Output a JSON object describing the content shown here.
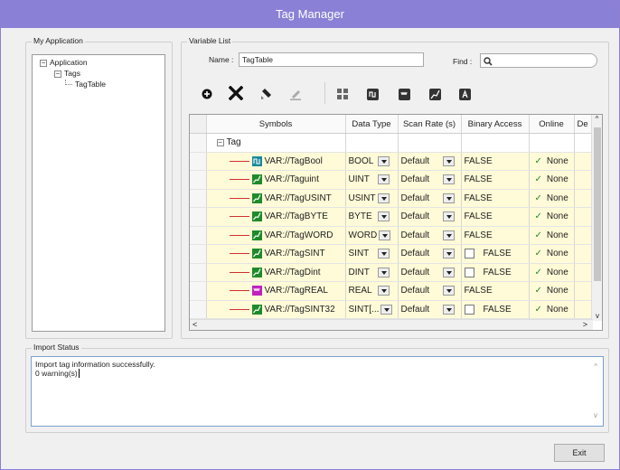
{
  "window": {
    "title": "Tag Manager"
  },
  "app_panel": {
    "title": "My Application",
    "tree": [
      {
        "label": "Application",
        "toggle": "−"
      },
      {
        "label": "Tags",
        "toggle": "−"
      },
      {
        "label": "TagTable",
        "toggle": ""
      }
    ]
  },
  "variable_list": {
    "title": "Variable List",
    "name_label": "Name :",
    "name_value": "TagTable",
    "find_label": "Find :",
    "find_value": ""
  },
  "toolbar": {
    "icons": [
      "add-icon",
      "delete-icon",
      "rename-icon",
      "edit-icon",
      "bool-type-icon",
      "uint-type-icon",
      "real-type-icon",
      "int-type-icon",
      "string-type-icon"
    ]
  },
  "grid": {
    "columns": [
      "Symbols",
      "Data Type",
      "Scan Rate (s)",
      "Binary Access",
      "Online",
      "De"
    ],
    "group_label": "Tag",
    "rows": [
      {
        "symbol": "VAR://TagBool",
        "icon": "bool",
        "data_type": "BOOL",
        "scan_rate": "Default",
        "binary_access": "FALSE",
        "binary_checkbox": false,
        "online": "None"
      },
      {
        "symbol": "VAR://Taguint",
        "icon": "int",
        "data_type": "UINT",
        "scan_rate": "Default",
        "binary_access": "FALSE",
        "binary_checkbox": false,
        "online": "None"
      },
      {
        "symbol": "VAR://TagUSINT",
        "icon": "int",
        "data_type": "USINT",
        "scan_rate": "Default",
        "binary_access": "FALSE",
        "binary_checkbox": false,
        "online": "None"
      },
      {
        "symbol": "VAR://TagBYTE",
        "icon": "int",
        "data_type": "BYTE",
        "scan_rate": "Default",
        "binary_access": "FALSE",
        "binary_checkbox": false,
        "online": "None"
      },
      {
        "symbol": "VAR://TagWORD",
        "icon": "int",
        "data_type": "WORD",
        "scan_rate": "Default",
        "binary_access": "FALSE",
        "binary_checkbox": false,
        "online": "None"
      },
      {
        "symbol": "VAR://TagSINT",
        "icon": "int",
        "data_type": "SINT",
        "scan_rate": "Default",
        "binary_access": "FALSE",
        "binary_checkbox": true,
        "online": "None"
      },
      {
        "symbol": "VAR://TagDint",
        "icon": "int",
        "data_type": "DINT",
        "scan_rate": "Default",
        "binary_access": "FALSE",
        "binary_checkbox": true,
        "online": "None"
      },
      {
        "symbol": "VAR://TagREAL",
        "icon": "real",
        "data_type": "REAL",
        "scan_rate": "Default",
        "binary_access": "FALSE",
        "binary_checkbox": false,
        "online": "None"
      },
      {
        "symbol": "VAR://TagSINT32",
        "icon": "int",
        "data_type": "SINT[...",
        "scan_rate": "Default",
        "binary_access": "FALSE",
        "binary_checkbox": true,
        "online": "None"
      }
    ]
  },
  "import_status": {
    "title": "Import Status",
    "lines": [
      "Import tag information successfully.",
      "0 warning(s)"
    ]
  },
  "exit_button": {
    "label": "Exit"
  },
  "colors": {
    "titlebar": "#8a80d6",
    "grid_row_bg": "#fffbd8",
    "tree_line": "#d03030",
    "bool_icon": "#1a8a9a",
    "int_icon": "#1f8a2a",
    "real_icon": "#c020c0"
  }
}
